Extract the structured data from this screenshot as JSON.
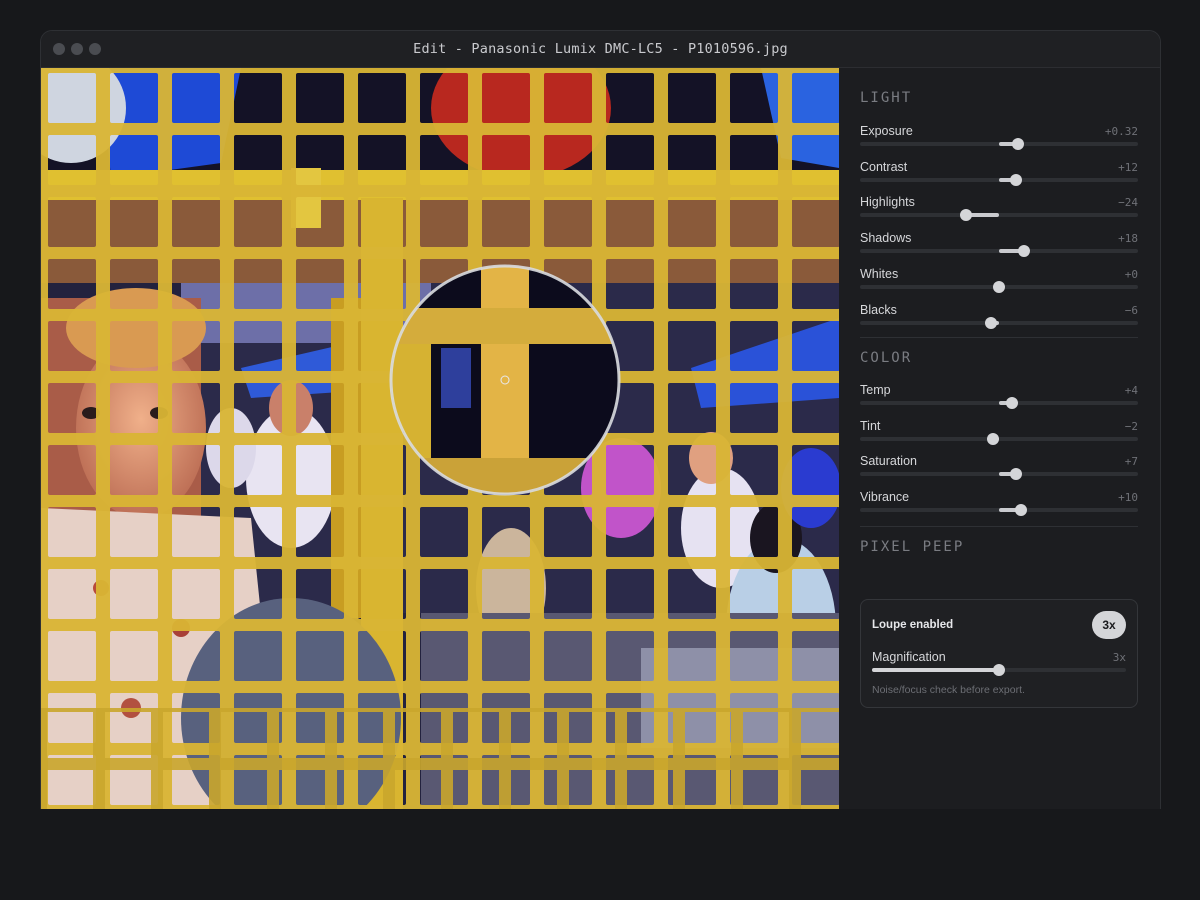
{
  "window": {
    "title": "Edit - Panasonic Lumix DMC-LC5 - P1010596.jpg"
  },
  "panel": {
    "light": {
      "title": "LIGHT",
      "sliders": [
        {
          "label": "Exposure",
          "value": "+0.32",
          "level": 0.57
        },
        {
          "label": "Contrast",
          "value": "+12",
          "level": 0.56
        },
        {
          "label": "Highlights",
          "value": "−24",
          "level": 0.38
        },
        {
          "label": "Shadows",
          "value": "+18",
          "level": 0.59
        },
        {
          "label": "Whites",
          "value": "+0",
          "level": 0.5
        },
        {
          "label": "Blacks",
          "value": "−6",
          "level": 0.47
        }
      ]
    },
    "color": {
      "title": "COLOR",
      "sliders": [
        {
          "label": "Temp",
          "value": "+4",
          "level": 0.545
        },
        {
          "label": "Tint",
          "value": "−2",
          "level": 0.48
        },
        {
          "label": "Saturation",
          "value": "+7",
          "level": 0.56
        },
        {
          "label": "Vibrance",
          "value": "+10",
          "level": 0.58
        }
      ]
    },
    "pixel_peep": {
      "title": "PIXEL PEEP",
      "loupe_label": "Loupe enabled",
      "badge": "3x",
      "magnification_label": "Magnification",
      "magnification_value": "3x",
      "magnification_level": 0.5,
      "note": "Noise/focus check before export."
    }
  },
  "colors": {
    "accent": "#d4d5d8",
    "background": "#17181b",
    "panel": "#1c1d20",
    "fence": "#d8b632",
    "photo_shadow": "#1a1838"
  },
  "icons": {
    "window_controls": [
      "close-dot-icon",
      "minimize-dot-icon",
      "zoom-dot-icon"
    ],
    "loupe": "magnifier-loupe-icon"
  }
}
